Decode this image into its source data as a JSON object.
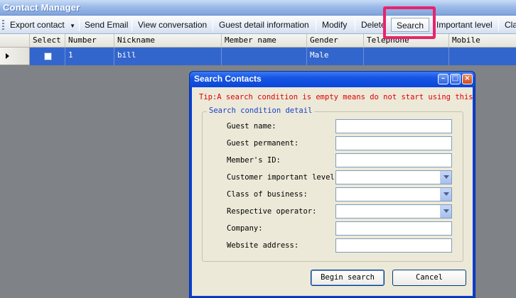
{
  "window": {
    "title": "Contact Manager"
  },
  "toolbar": {
    "items": [
      {
        "label": "Export contact",
        "has_dropdown": true
      },
      {
        "label": "Send Email"
      },
      {
        "label": "View conversation"
      },
      {
        "label": "Guest detail information"
      },
      {
        "label": "Modify"
      },
      {
        "label": "Delete"
      },
      {
        "label": "Search",
        "highlighted": true
      },
      {
        "label": "Important level"
      },
      {
        "label": "Cla"
      }
    ]
  },
  "grid": {
    "columns": [
      "Select",
      "Number",
      "Nickname",
      "Member name",
      "Gender",
      "Telephone",
      "Mobile"
    ],
    "rows": [
      {
        "selected": true,
        "checked": false,
        "number": "1",
        "nickname": "bill",
        "member_name": "",
        "gender": "Male",
        "telephone": "",
        "mobile": ""
      }
    ]
  },
  "dialog": {
    "title": "Search Contacts",
    "tip": "Tip:A search condition is empty means do not start using this con",
    "group_label": "Search condition detail",
    "fields": [
      {
        "label": "Guest name:",
        "type": "text",
        "value": ""
      },
      {
        "label": "Guest permanent:",
        "type": "text",
        "value": ""
      },
      {
        "label": "Member's ID:",
        "type": "text",
        "value": ""
      },
      {
        "label": "Customer important level:",
        "type": "select",
        "value": ""
      },
      {
        "label": "Class of business:",
        "type": "select",
        "value": ""
      },
      {
        "label": "Respective operator:",
        "type": "select",
        "value": ""
      },
      {
        "label": "Company:",
        "type": "text",
        "value": ""
      },
      {
        "label": "Website address:",
        "type": "text",
        "value": ""
      }
    ],
    "buttons": {
      "begin_search": "Begin search",
      "cancel": "Cancel"
    }
  },
  "colors": {
    "highlight_box": "#e8246b",
    "selected_row": "#3366cc",
    "tip_text": "#e00000",
    "dialog_frame": "#0a3fd2"
  }
}
